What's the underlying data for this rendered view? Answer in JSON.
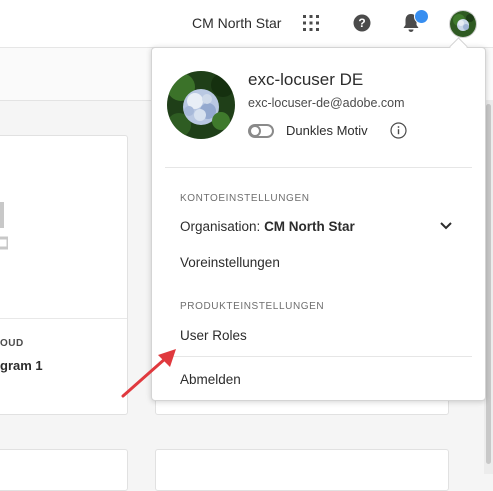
{
  "header": {
    "org_name": "CM North Star",
    "icons": [
      "apps-grid-icon",
      "help-icon",
      "bell-icon",
      "avatar"
    ],
    "notification_color": "#378ef0"
  },
  "background_card": {
    "kicker": "OUD",
    "title": "gram 1"
  },
  "profile": {
    "name": "exc-locuser DE",
    "email": "exc-locuser-de@adobe.com",
    "theme_label": "Dunkles Motiv"
  },
  "account_section": {
    "heading": "KONTOEINSTELLUNGEN",
    "org_prefix": "Organisation:",
    "org_name": "CM North Star",
    "preferences": "Voreinstellungen"
  },
  "product_section": {
    "heading": "PRODUKTEINSTELLUNGEN",
    "user_roles": "User Roles"
  },
  "signout": "Abmelden",
  "colors": {
    "annotation_arrow": "#e0393e",
    "text": "#2c2c2c",
    "muted": "#6e6e6e"
  }
}
